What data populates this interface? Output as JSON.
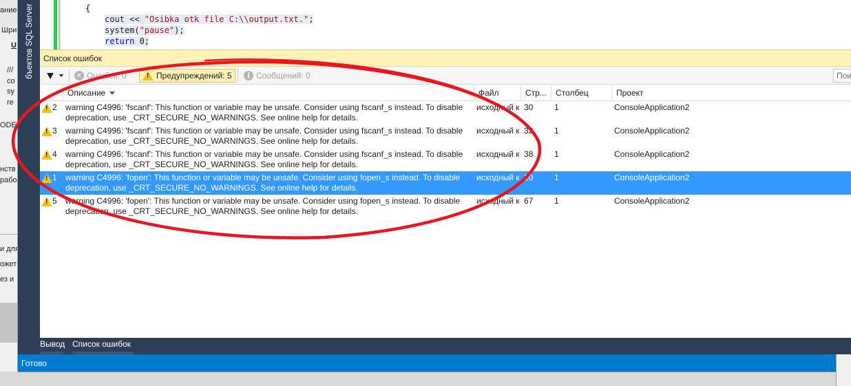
{
  "background_window": {
    "fragments": [
      "ание:",
      "Шри",
      "U",
      "///",
      "co",
      "sy",
      "re",
      "ODE",
      "нств",
      "рабо",
      "и для",
      "ожет",
      "ез и"
    ]
  },
  "sql_tab": {
    "label": "Обозреватель объектов SQL Server",
    "visible_label": "бъектов SQL Server"
  },
  "editor": {
    "lines": {
      "brace": "{",
      "cout_prefix": "cout << ",
      "cout_string": "\"Osibka otk file C:\\\\output.txt.\"",
      "cout_suffix": ";",
      "system_prefix": "system(",
      "system_string": "\"pause\"",
      "system_suffix": ");",
      "return_kw": "return",
      "return_suffix": " 0;"
    }
  },
  "error_list": {
    "title": "Список ошибок",
    "toolbar": {
      "errors_label": "Ошибок: 0",
      "warnings_label": "Предупреждений: 5",
      "messages_label": "Сообщений: 0",
      "search_placeholder": "Пои"
    },
    "columns": {
      "description": "Описание",
      "file": "Файл",
      "line": "Стр...",
      "column": "Столбец",
      "project": "Проект"
    },
    "rows": [
      {
        "num": "2",
        "description": "warning C4996: 'fscanf': This function or variable may be unsafe. Consider using fscanf_s instead. To disable deprecation, use _CRT_SECURE_NO_WARNINGS. See online help for details.",
        "file": "исходный к",
        "line": "30",
        "column": "1",
        "project": "ConsoleApplication2"
      },
      {
        "num": "3",
        "description": "warning C4996: 'fscanf': This function or variable may be unsafe. Consider using fscanf_s instead. To disable deprecation, use _CRT_SECURE_NO_WARNINGS. See online help for details.",
        "file": "исходный к",
        "line": "32",
        "column": "1",
        "project": "ConsoleApplication2"
      },
      {
        "num": "4",
        "description": "warning C4996: 'fscanf': This function or variable may be unsafe. Consider using fscanf_s instead. To disable deprecation, use _CRT_SECURE_NO_WARNINGS. See online help for details.",
        "file": "исходный к",
        "line": "38",
        "column": "1",
        "project": "ConsoleApplication2"
      },
      {
        "num": "1",
        "description": "warning C4996: 'fopen': This function or variable may be unsafe. Consider using fopen_s instead. To disable deprecation, use _CRT_SECURE_NO_WARNINGS. See online help for details.",
        "file": "исходный к",
        "line": "20",
        "column": "1",
        "project": "ConsoleApplication2",
        "selected": true
      },
      {
        "num": "5",
        "description": "warning C4996: 'fopen': This function or variable may be unsafe. Consider using fopen_s instead. To disable deprecation, use _CRT_SECURE_NO_WARNINGS. See online help for details.",
        "file": "исходный к",
        "line": "67",
        "column": "1",
        "project": "ConsoleApplication2"
      }
    ]
  },
  "bottom_tabs": {
    "output": "Вывод",
    "error_list": "Список ошибок"
  },
  "status_bar": {
    "text": "Готово"
  },
  "colors": {
    "accent_blue": "#007acc",
    "selection": "#3399ff",
    "panel_title_bg": "#fff1b8",
    "annotation_red": "#e8161f",
    "warning_yellow": "#f0c419"
  }
}
